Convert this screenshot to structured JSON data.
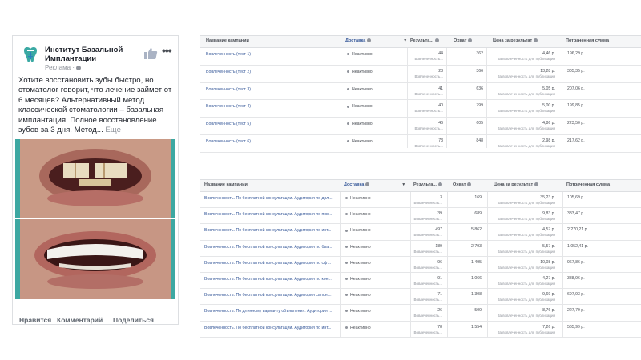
{
  "ad": {
    "page_name": "Институт Базальной Имплантации",
    "sponsored": "Реклама · ",
    "text": "Хотите восстановить зубы быстро, но стоматолог говорит, что лечение займет от 6 месяцев? Альтернативный метод классической стоматологии – базальная имплантация. Полное восстановление зубов за 3 дня. Метод...",
    "more": "Еще",
    "actions": {
      "like": "Нравится",
      "comment": "Комментарий",
      "share": "Поделиться"
    },
    "colors": {
      "brand_teal": "#3aa9a3",
      "logo_blue": "#2c7fbf"
    }
  },
  "tables": [
    {
      "headers": {
        "name": "Название кампании",
        "delivery": "Доставка",
        "results": "Результа...",
        "reach": "Охват",
        "cost": "Цена за результат",
        "spent": "Потраченная сумма"
      },
      "rows": [
        {
          "name": "Вовлеченность (тест 1)",
          "delivery": "Неактивно",
          "results": "44",
          "results_sub": "Вовлеченность...",
          "reach": "362",
          "cost": "4,46 р.",
          "cost_sub": "За вовлеченность для публикации",
          "spent": "196,29 р."
        },
        {
          "name": "Вовлеченность (тест 2)",
          "delivery": "Неактивно",
          "results": "23",
          "results_sub": "Вовлеченность...",
          "reach": "366",
          "cost": "13,28 р.",
          "cost_sub": "За вовлеченность для публикации",
          "spent": "305,35 р."
        },
        {
          "name": "Вовлеченность (тест 3)",
          "delivery": "Неактивно",
          "results": "41",
          "results_sub": "Вовлеченность...",
          "reach": "636",
          "cost": "5,05 р.",
          "cost_sub": "За вовлеченность для публикации",
          "spent": "207,06 р."
        },
        {
          "name": "Вовлеченность (тест 4)",
          "delivery": "Неактивно",
          "results": "40",
          "results_sub": "Вовлеченность...",
          "reach": "799",
          "cost": "5,00 р.",
          "cost_sub": "За вовлеченность для публикации",
          "spent": "199,85 р."
        },
        {
          "name": "Вовлеченность (тест 5)",
          "delivery": "Неактивно",
          "results": "46",
          "results_sub": "Вовлеченность...",
          "reach": "605",
          "cost": "4,86 р.",
          "cost_sub": "За вовлеченность для публикации",
          "spent": "223,50 р."
        },
        {
          "name": "Вовлеченность (тест 6)",
          "delivery": "Неактивно",
          "results": "73",
          "results_sub": "Вовлеченность...",
          "reach": "848",
          "cost": "2,98 р.",
          "cost_sub": "За вовлеченность для публикации",
          "spent": "217,62 р."
        }
      ]
    },
    {
      "headers": {
        "name": "Название кампании",
        "delivery": "Доставка",
        "results": "Результа...",
        "reach": "Охват",
        "cost": "Цена за результат",
        "spent": "Потраченная сумма"
      },
      "rows": [
        {
          "name": "Вовлеченность. По бесплатной консультации. Аудитория по дол...",
          "delivery": "Неактивно",
          "results": "3",
          "results_sub": "Вовлеченность...",
          "reach": "169",
          "cost": "35,23 р.",
          "cost_sub": "За вовлеченность для публикации",
          "spent": "105,69 р."
        },
        {
          "name": "Вовлеченность. По бесплатной консультации. Аудитория по пов...",
          "delivery": "Неактивно",
          "results": "39",
          "results_sub": "Вовлеченность...",
          "reach": "689",
          "cost": "9,83 р.",
          "cost_sub": "За вовлеченность для публикации",
          "spent": "383,47 р."
        },
        {
          "name": "Вовлеченность. По бесплатной консультации. Аудитория по инт...",
          "delivery": "Неактивно",
          "results": "497",
          "results_sub": "Вовлеченность...",
          "reach": "5 862",
          "cost": "4,57 р.",
          "cost_sub": "За вовлеченность для публикации",
          "spent": "2 270,21 р."
        },
        {
          "name": "Вовлеченность. По бесплатной консультации. Аудитория по бла...",
          "delivery": "Неактивно",
          "results": "189",
          "results_sub": "Вовлеченность...",
          "reach": "2 793",
          "cost": "5,57 р.",
          "cost_sub": "За вовлеченность для публикации",
          "spent": "1 052,41 р."
        },
        {
          "name": "Вовлеченность. По бесплатной консультации. Аудитория по сфе...",
          "delivery": "Неактивно",
          "results": "96",
          "results_sub": "Вовлеченность...",
          "reach": "1 495",
          "cost": "10,08 р.",
          "cost_sub": "За вовлеченность для публикации",
          "spent": "967,86 р."
        },
        {
          "name": "Вовлеченность. По бесплатной консультации. Аудитория по кон...",
          "delivery": "Неактивно",
          "results": "91",
          "results_sub": "Вовлеченность...",
          "reach": "1 066",
          "cost": "4,27 р.",
          "cost_sub": "За вовлеченность для публикации",
          "spent": "388,96 р."
        },
        {
          "name": "Вовлеченность. По бесплатной консультации. Аудитория салоно...",
          "delivery": "Неактивно",
          "results": "71",
          "results_sub": "Вовлеченность...",
          "reach": "1 308",
          "cost": "9,69 р.",
          "cost_sub": "За вовлеченность для публикации",
          "spent": "697,93 р."
        },
        {
          "name": "Вовлеченность. По длинному варианту объявления. Аудитория ...",
          "delivery": "Неактивно",
          "results": "26",
          "results_sub": "Вовлеченность...",
          "reach": "509",
          "cost": "8,76 р.",
          "cost_sub": "За вовлеченность для публикации",
          "spent": "227,79 р."
        },
        {
          "name": "Вовлеченность. По бесплатной консультации. Аудитория по инт...",
          "delivery": "Неактивно",
          "results": "78",
          "results_sub": "Вовлеченность...",
          "reach": "1 554",
          "cost": "7,26 р.",
          "cost_sub": "За вовлеченность для публикации",
          "spent": "565,99 р."
        }
      ]
    }
  ]
}
